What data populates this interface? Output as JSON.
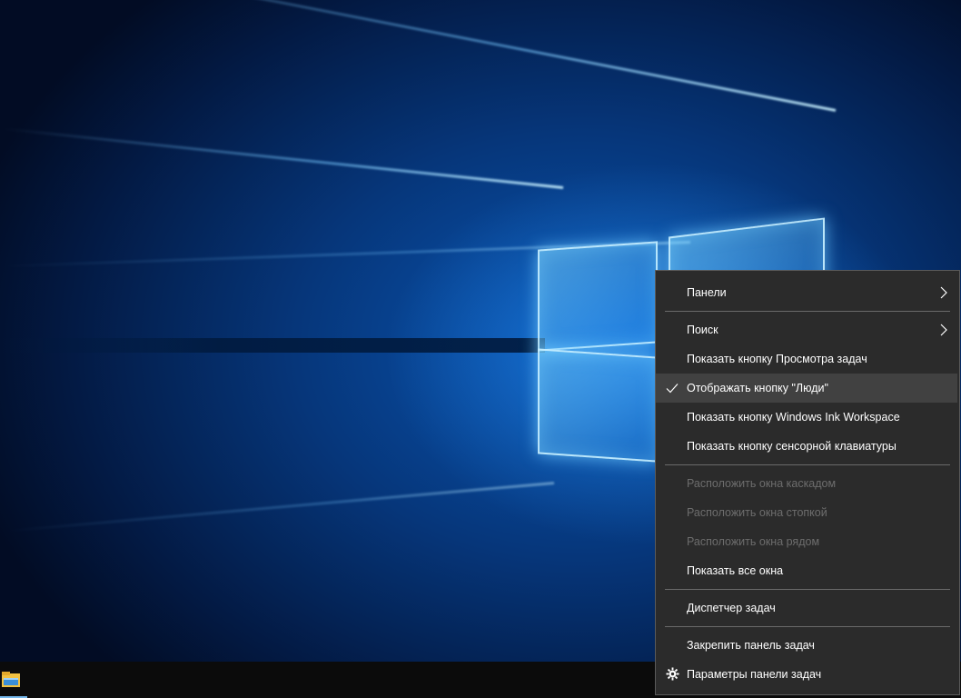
{
  "desktop": {
    "wallpaper": "windows-10-hero",
    "accent": "#0a57b5"
  },
  "taskbar": {
    "icons": [
      {
        "name": "file-explorer-icon"
      }
    ]
  },
  "context_menu": {
    "items": [
      {
        "label": "Панели",
        "submenu": true
      },
      {
        "label": "Поиск",
        "submenu": true
      },
      {
        "label": "Показать кнопку Просмотра задач"
      },
      {
        "label": "Отображать кнопку \"Люди\"",
        "checked": true
      },
      {
        "label": "Показать кнопку Windows Ink Workspace"
      },
      {
        "label": "Показать кнопку сенсорной клавиатуры"
      },
      {
        "label": "Расположить окна каскадом",
        "disabled": true
      },
      {
        "label": "Расположить окна стопкой",
        "disabled": true
      },
      {
        "label": "Расположить окна рядом",
        "disabled": true
      },
      {
        "label": "Показать все окна"
      },
      {
        "label": "Диспетчер задач"
      },
      {
        "label": "Закрепить панель задач"
      },
      {
        "label": "Параметры панели задач",
        "icon": "gear-icon"
      }
    ],
    "colors": {
      "background": "#2b2b2b",
      "text": "#ffffff",
      "disabled_text": "#6d6d6d",
      "highlight": "#414141"
    }
  }
}
